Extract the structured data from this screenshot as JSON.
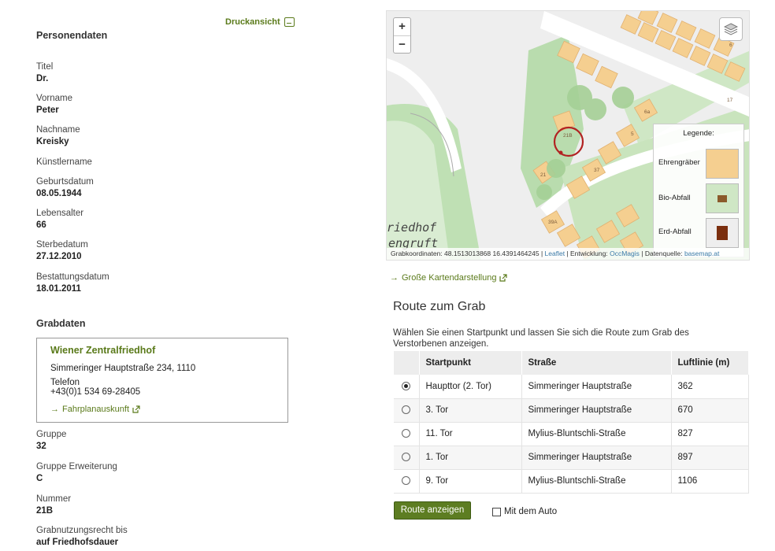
{
  "print_label": "Druckansicht",
  "person": {
    "section_title": "Personendaten",
    "fields": [
      {
        "label": "Titel",
        "value": "Dr."
      },
      {
        "label": "Vorname",
        "value": "Peter"
      },
      {
        "label": "Nachname",
        "value": "Kreisky"
      },
      {
        "label": "Künstlername",
        "value": ""
      },
      {
        "label": "Geburtsdatum",
        "value": "08.05.1944"
      },
      {
        "label": "Lebensalter",
        "value": "66"
      },
      {
        "label": "Sterbedatum",
        "value": "27.12.2010"
      },
      {
        "label": "Bestattungsdatum",
        "value": "18.01.2011"
      }
    ]
  },
  "grave": {
    "section_title": "Grabdaten",
    "cemetery": {
      "name": "Wiener Zentralfriedhof",
      "address": "Simmeringer Hauptstraße 234, 1110",
      "phone_label": "Telefon",
      "phone": "+43(0)1 534 69-28405",
      "link": "Fahrplanauskunft"
    },
    "fields": [
      {
        "label": "Gruppe",
        "value": "32"
      },
      {
        "label": "Gruppe Erweiterung",
        "value": "C"
      },
      {
        "label": "Nummer",
        "value": "21B"
      },
      {
        "label": "Grabnutzungsrecht bis",
        "value": "auf Friedhofsdauer"
      }
    ]
  },
  "map": {
    "zoom_in": "+",
    "zoom_out": "−",
    "legend_title": "Legende:",
    "legend_items": [
      "Ehrengräber",
      "Bio-Abfall",
      "Erd-Abfall"
    ],
    "label_top": "riedhof",
    "label_bottom": "engruft",
    "parcel_labels": [
      "21B",
      "21",
      "6",
      "17",
      "6a",
      "5",
      "37",
      "39A"
    ],
    "attribution": {
      "coords": "Grabkoordinaten: 48.1513013868 16.4391464245",
      "leaflet": "Leaflet",
      "dev_label": "Entwicklung:",
      "dev": "OccMagis",
      "source_label": "Datenquelle:",
      "source": "basemap.at"
    },
    "large_map_link": "Große Kartendarstellung"
  },
  "route": {
    "title": "Route zum Grab",
    "description": "Wählen Sie einen Startpunkt und lassen Sie sich die Route zum Grab des Verstorbenen anzeigen.",
    "columns": [
      "Startpunkt",
      "Straße",
      "Luftlinie (m)"
    ],
    "rows": [
      {
        "start": "Haupttor (2. Tor)",
        "street": "Simmeringer Hauptstraße",
        "distance": "362",
        "selected": true
      },
      {
        "start": "3. Tor",
        "street": "Simmeringer Hauptstraße",
        "distance": "670",
        "selected": false
      },
      {
        "start": "11. Tor",
        "street": "Mylius-Bluntschli-Straße",
        "distance": "827",
        "selected": false
      },
      {
        "start": "1. Tor",
        "street": "Simmeringer Hauptstraße",
        "distance": "897",
        "selected": false
      },
      {
        "start": "9. Tor",
        "street": "Mylius-Bluntschli-Straße",
        "distance": "1106",
        "selected": false
      }
    ],
    "button": "Route anzeigen",
    "checkbox": "Mit dem Auto"
  },
  "colors": {
    "accent": "#5a7a1a",
    "button": "#5d7d22",
    "parcel": "#f5cf90",
    "green": "#b9dcae",
    "marker": "#b22222"
  }
}
